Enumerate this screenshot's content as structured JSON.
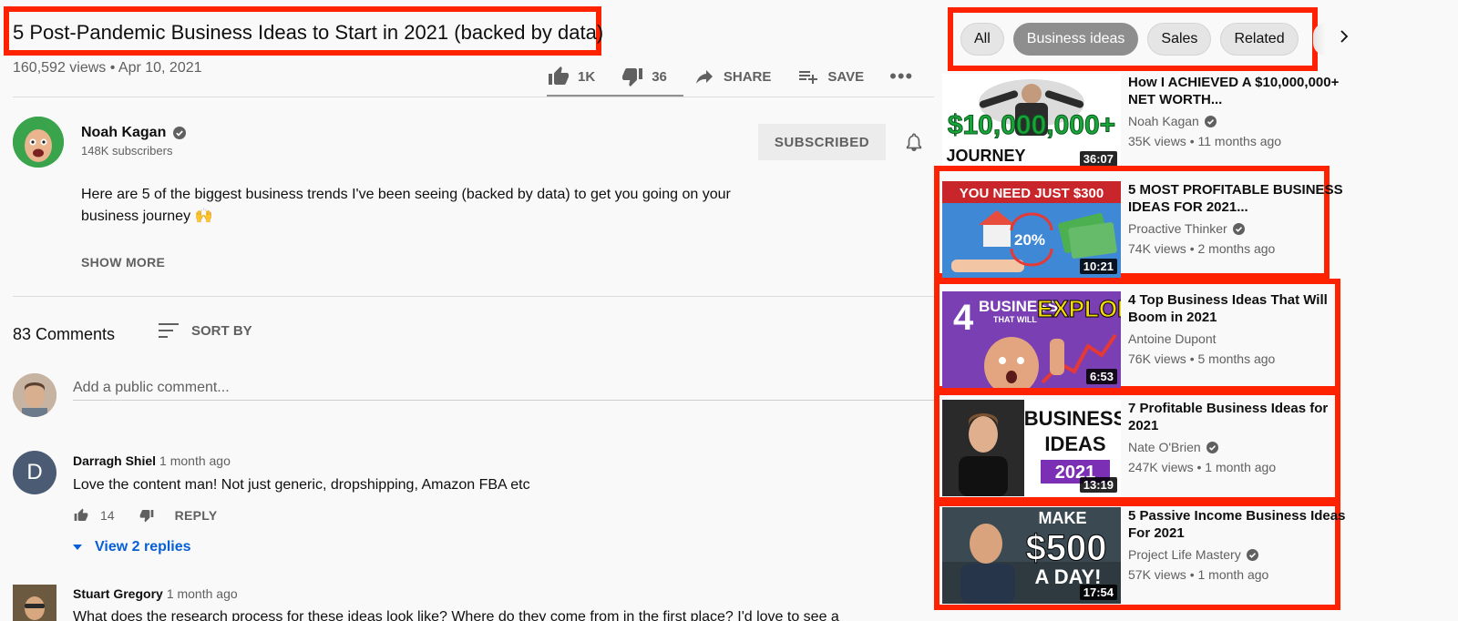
{
  "video": {
    "title": "5 Post-Pandemic Business Ideas to Start in 2021 (backed by data)",
    "meta": "160,592 views • Apr 10, 2021",
    "likes": "1K",
    "dislikes": "36",
    "share_label": "SHARE",
    "save_label": "SAVE",
    "more_label": "•••"
  },
  "channel": {
    "name": "Noah Kagan",
    "subscribers": "148K subscribers",
    "subscribe_label": "SUBSCRIBED"
  },
  "description": {
    "text": "Here are 5 of the biggest business trends I've been seeing (backed by data) to get you going on your business journey 🙌",
    "show_more": "SHOW MORE"
  },
  "comments": {
    "count": "83 Comments",
    "sort_label": "SORT BY",
    "placeholder": "Add a public comment...",
    "items": [
      {
        "initial": "D",
        "author": "Darragh Shiel",
        "time": "1 month ago",
        "text": "Love the content man! Not just generic, dropshipping, Amazon FBA etc",
        "likes": "14",
        "reply_label": "REPLY",
        "view_replies": "View 2 replies"
      },
      {
        "author": "Stuart Gregory",
        "time": "1 month ago",
        "text": "What does the research process for these ideas look like? Where do they come from in the first place? I'd love to see a"
      }
    ]
  },
  "chips": [
    "All",
    "Business ideas",
    "Sales",
    "Related"
  ],
  "chip_active": "Business ideas",
  "recommended": [
    {
      "title": "How I ACHIEVED A $10,000,000+ NET WORTH...",
      "channel": "Noah Kagan",
      "meta": "35K views • 11 months ago",
      "duration": "36:07",
      "thumb_text": [
        "$10,000,000+",
        "JOURNEY"
      ]
    },
    {
      "title": "5 MOST PROFITABLE BUSINESS IDEAS FOR 2021...",
      "channel": "Proactive Thinker",
      "meta": "74K views • 2 months ago",
      "duration": "10:21",
      "thumb_text": [
        "YOU NEED JUST $300",
        "20%"
      ]
    },
    {
      "title": "4 Top Business Ideas That Will Boom in 2021",
      "channel": "Antoine Dupont",
      "meta": "76K views • 5 months ago",
      "duration": "6:53",
      "thumb_text": [
        "4",
        "BUSINESS",
        "THAT WILL",
        "EXPLODE"
      ]
    },
    {
      "title": "7 Profitable Business Ideas for 2021",
      "channel": "Nate O'Brien",
      "meta": "247K views • 1 month ago",
      "duration": "13:19",
      "thumb_text": [
        "BUSINESS",
        "IDEAS",
        "2021"
      ]
    },
    {
      "title": "5 Passive Income Business Ideas For 2021",
      "channel": "Project Life Mastery",
      "meta": "57K views • 1 month ago",
      "duration": "17:54",
      "thumb_text": [
        "MAKE",
        "$500",
        "A DAY!"
      ]
    }
  ],
  "colors": {
    "highlight": "#ff2200",
    "link": "#065fd4",
    "muted": "#606060"
  }
}
